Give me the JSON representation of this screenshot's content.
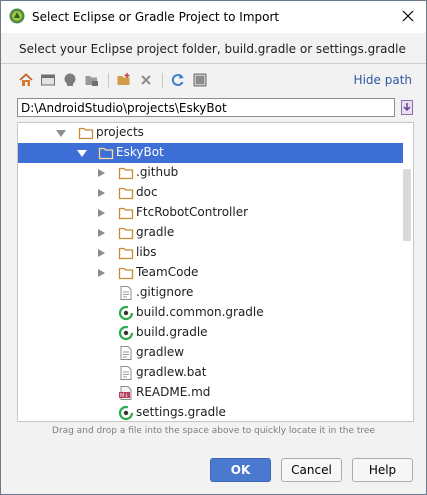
{
  "window": {
    "title": "Select Eclipse or Gradle Project to Import",
    "close_icon": "close-icon"
  },
  "header": {
    "instruction": "Select your Eclipse project folder, build.gradle or settings.gradle"
  },
  "toolbar": {
    "buttons": [
      "home-icon",
      "desktop-icon",
      "project-icon",
      "module-icon",
      "new-folder-icon",
      "delete-icon",
      "refresh-icon",
      "show-hidden-icon"
    ],
    "hide_path_label": "Hide path"
  },
  "path": {
    "value": "D:\\AndroidStudio\\projects\\EskyBot"
  },
  "tree": {
    "items": [
      {
        "label": "projects",
        "type": "folder",
        "expanded": true,
        "depth": 0
      },
      {
        "label": "EskyBot",
        "type": "folder",
        "expanded": true,
        "selected": true,
        "depth": 1
      },
      {
        "label": ".github",
        "type": "folder",
        "depth": 2
      },
      {
        "label": "doc",
        "type": "folder",
        "depth": 2
      },
      {
        "label": "FtcRobotController",
        "type": "folder",
        "depth": 2
      },
      {
        "label": "gradle",
        "type": "folder",
        "depth": 2
      },
      {
        "label": "libs",
        "type": "folder",
        "depth": 2
      },
      {
        "label": "TeamCode",
        "type": "folder",
        "depth": 2
      },
      {
        "label": ".gitignore",
        "type": "text-file",
        "depth": 2
      },
      {
        "label": "build.common.gradle",
        "type": "gradle-file",
        "depth": 2
      },
      {
        "label": "build.gradle",
        "type": "gradle-file",
        "depth": 2
      },
      {
        "label": "gradlew",
        "type": "text-file",
        "depth": 2
      },
      {
        "label": "gradlew.bat",
        "type": "text-file",
        "depth": 2
      },
      {
        "label": "README.md",
        "type": "markdown-file",
        "depth": 2
      },
      {
        "label": "settings.gradle",
        "type": "gradle-file",
        "depth": 2
      }
    ]
  },
  "hint": "Drag and drop a file into the space above to quickly locate it in the tree",
  "buttons": {
    "ok": "OK",
    "cancel": "Cancel",
    "help": "Help"
  },
  "colors": {
    "selection": "#3d6fd6",
    "folder": "#d39b47",
    "gradle": "#2aa84a",
    "link": "#2f57a3",
    "primary_button": "#4a7ad0"
  }
}
